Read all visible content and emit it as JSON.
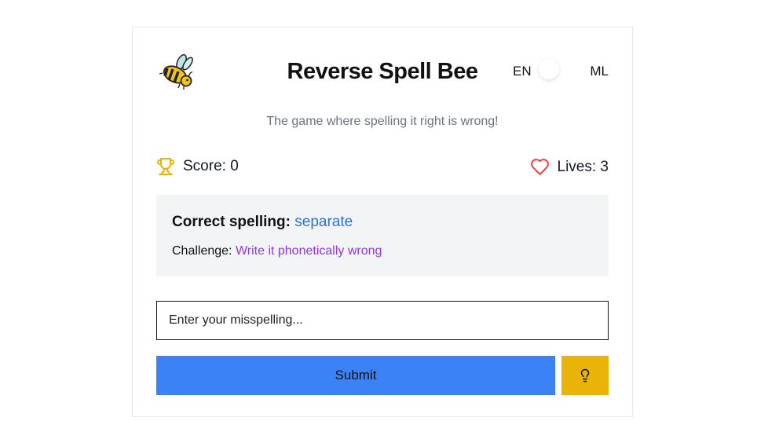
{
  "header": {
    "logo_icon": "bee-icon",
    "title": "Reverse Spell Bee",
    "language": {
      "left_label": "EN",
      "right_label": "ML",
      "selected": "EN"
    }
  },
  "subtitle": "The game where spelling it right is wrong!",
  "stats": {
    "score_icon": "trophy-icon",
    "score_text": "Score: 0",
    "lives_icon": "heart-icon",
    "lives_text": "Lives: 3"
  },
  "challenge": {
    "correct_label": "Correct spelling:",
    "correct_word": "separate",
    "challenge_label": "Challenge:",
    "challenge_text": "Write it phonetically wrong"
  },
  "input": {
    "placeholder": "Enter your misspelling...",
    "value": ""
  },
  "actions": {
    "submit_label": "Submit",
    "hint_icon": "lightbulb-icon"
  },
  "colors": {
    "accent_blue": "#3b82f6",
    "hint_yellow": "#eab308",
    "trophy": "#eab308",
    "heart": "#ef4444",
    "word_blue": "#2f6fdf",
    "challenge_purple": "#9333ea",
    "panel_gray": "#f3f4f6"
  }
}
